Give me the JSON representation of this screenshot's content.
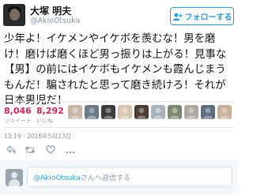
{
  "user": {
    "display_name": "大塚 明夫",
    "handle": "@AkioOtsuka",
    "follow_label": "フォローする"
  },
  "tweet": {
    "text": "少年よ！イケメンやイケボを羨むな！男を磨け！磨けば磨くほど男っ振りは上がる！見事な【男】の前にはイケボもイケメンも霞んじまうもんだ！騙されたと思って磨き続けろ！それが日本男児だ！",
    "timestamp": "13:19 - 2016年5月23日"
  },
  "stats": {
    "retweets": {
      "count": "8,046",
      "label": "リツイート"
    },
    "likes": {
      "count": "8,292",
      "label": "いいね"
    }
  },
  "likers": [
    {
      "icon": "liker-avatar-icon",
      "color": "#c9b8a8"
    },
    {
      "icon": "liker-avatar-icon",
      "color": "#6b7b8c"
    },
    {
      "icon": "liker-avatar-icon",
      "color": "#3d3d3d"
    },
    {
      "icon": "liker-avatar-icon",
      "color": "#d8c6b0"
    },
    {
      "icon": "liker-avatar-icon",
      "color": "#4a3b33"
    },
    {
      "icon": "liker-avatar-icon",
      "color": "#a9b3bd"
    },
    {
      "icon": "liker-avatar-icon",
      "color": "#7e8a70"
    },
    {
      "icon": "liker-avatar-icon",
      "color": "#b0a89d"
    },
    {
      "icon": "liker-avatar-icon",
      "color": "#5f6e7f"
    },
    {
      "icon": "liker-avatar-icon",
      "color": "#c7b29a"
    }
  ],
  "actions": [
    {
      "icon": "reply-icon",
      "color": "#8899a6"
    },
    {
      "icon": "retweet-icon",
      "color": "#8899a6"
    },
    {
      "icon": "like-icon",
      "color": "#8899a6"
    },
    {
      "icon": "more-icon",
      "color": "#8899a6"
    }
  ],
  "reply": {
    "mention": "@AkioOtsuka",
    "placeholder": "さんへ返信する"
  },
  "colors": {
    "accent": "#1da1f2",
    "like": "#e0245e",
    "muted": "#8899a6"
  }
}
